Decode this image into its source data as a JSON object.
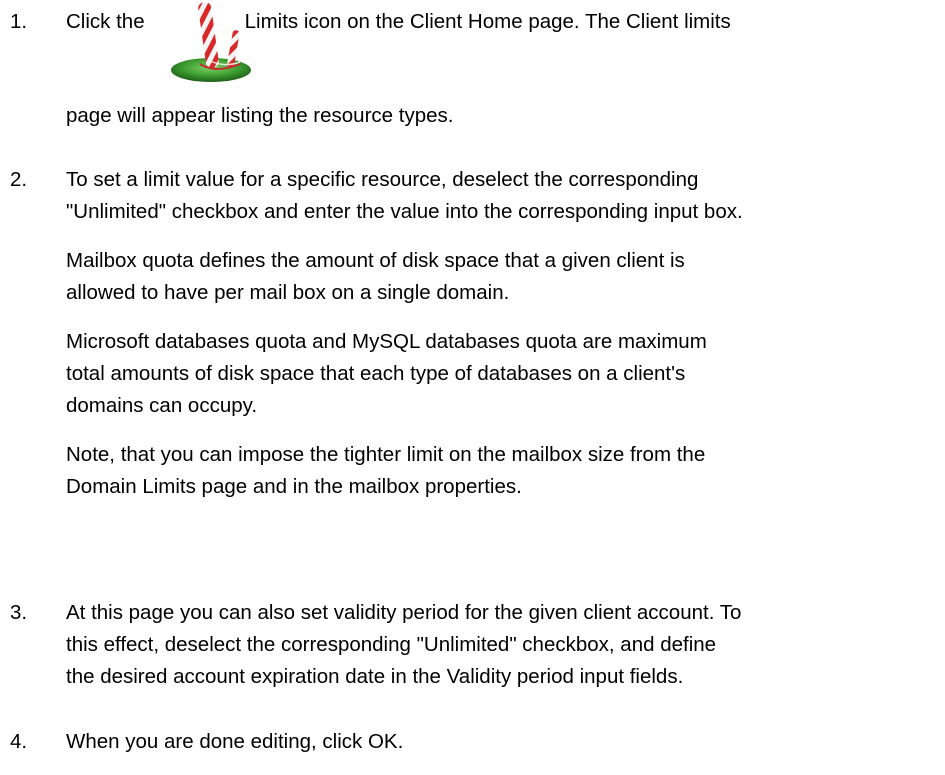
{
  "steps": [
    {
      "number": "1.",
      "paragraphs": [
        {
          "lines": [
            "Click the",
            "Limits icon on the Client Home page. The Client limits"
          ],
          "continuation": "page will appear listing the resource types."
        }
      ],
      "icon": "limits-icon"
    },
    {
      "number": "2.",
      "paragraphs": [
        {
          "lines": [
            "To set a limit value for a specific resource, deselect the corresponding",
            "\"Unlimited\" checkbox and enter the value into the corresponding input box."
          ]
        },
        {
          "lines": [
            "Mailbox quota defines the amount of disk space that a given client is",
            "allowed to have per mail box on a single domain."
          ]
        },
        {
          "lines": [
            "Microsoft databases quota and MySQL databases quota are maximum",
            "total amounts of disk space that each type of databases on a client's",
            "domains can occupy."
          ]
        },
        {
          "lines": [
            "Note, that you can impose the tighter limit on the mailbox size from the",
            "Domain Limits page and in the mailbox properties."
          ]
        }
      ]
    },
    {
      "number": "3.",
      "paragraphs": [
        {
          "lines": [
            "At this page you can also set validity period for the given client account. To",
            "this effect, deselect the corresponding \"Unlimited\" checkbox, and define",
            "the desired account expiration date in the Validity period input fields."
          ]
        }
      ]
    },
    {
      "number": "4.",
      "paragraphs": [
        {
          "lines": [
            "When you are done editing, click OK."
          ]
        }
      ]
    }
  ],
  "colors": {
    "text": "#000000",
    "background": "#ffffff",
    "pole_red": "#d9282a",
    "pole_white": "#f4f4f4",
    "grass": "#3a9a2e"
  }
}
